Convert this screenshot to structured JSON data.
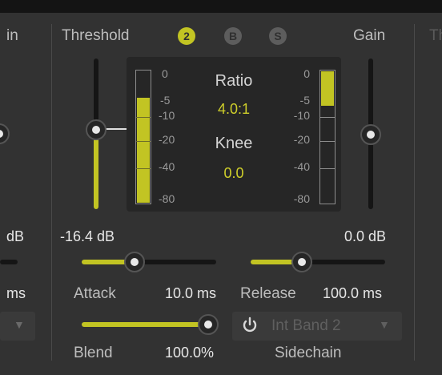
{
  "left_panel": {
    "partial_label": "in",
    "value": "dB",
    "attack_time": "ms"
  },
  "threshold": {
    "label": "Threshold",
    "value": "-16.4 dB"
  },
  "bands": [
    {
      "label": "2",
      "state": "on"
    },
    {
      "label": "B",
      "state": "off"
    },
    {
      "label": "S",
      "state": "off"
    }
  ],
  "gain": {
    "label": "Gain",
    "value": "0.0 dB",
    "partial_next": "Th"
  },
  "meter_scale_left": [
    "0",
    "-5",
    "-10",
    "-20",
    "-40",
    "-80"
  ],
  "meter_scale_right": [
    "0",
    "-5",
    "-10",
    "-20",
    "-40",
    "-80"
  ],
  "ratio": {
    "label": "Ratio",
    "value": "4.0:1"
  },
  "knee": {
    "label": "Knee",
    "value": "0.0"
  },
  "attack": {
    "label": "Attack",
    "value": "10.0 ms",
    "level": 0.45
  },
  "release": {
    "label": "Release",
    "value": "100.0 ms",
    "level": 0.4
  },
  "blend": {
    "label": "Blend",
    "value": "100.0",
    "unit": "%",
    "level": 1.0
  },
  "sidechain": {
    "label": "Sidechain",
    "selected": "Int Band 2"
  },
  "colors": {
    "accent": "#c2c423",
    "background": "#323232",
    "panel": "#262626"
  }
}
